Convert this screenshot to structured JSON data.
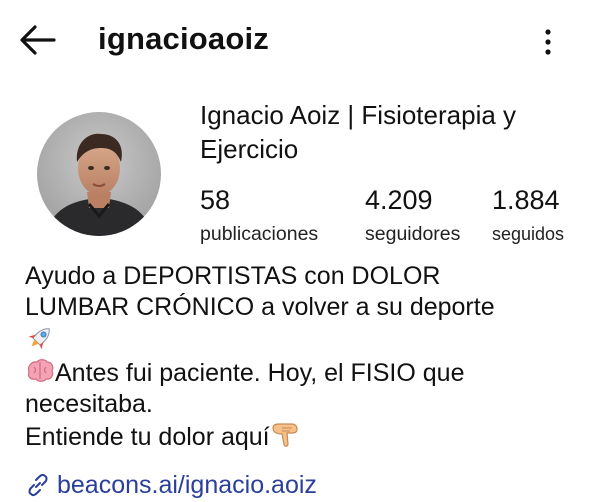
{
  "header": {
    "username": "ignacioaoiz",
    "back_icon": "arrow-left-icon",
    "more_icon": "more-vertical-icon"
  },
  "profile": {
    "full_name": "Ignacio Aoiz | Fisioterapia y Ejercicio",
    "stats": {
      "posts": {
        "value": "58",
        "label": "publicaciones"
      },
      "followers": {
        "value": "4.209",
        "label": "seguidores"
      },
      "following": {
        "value": "1.884",
        "label": "seguidos"
      }
    },
    "bio": {
      "line1": "Ayudo a DEPORTISTAS con DOLOR",
      "line2": "LUMBAR CRÓNICO a volver a su deporte",
      "line4": "Antes fui paciente. Hoy, el FISIO que",
      "line5": "necesitaba.",
      "line6": "Entiende tu dolor aquí"
    },
    "link": {
      "text": "beacons.ai/ignacio.aoiz",
      "icon": "link-icon"
    }
  },
  "colors": {
    "text": "#111111",
    "link": "#2a3f99",
    "background": "#ffffff"
  }
}
